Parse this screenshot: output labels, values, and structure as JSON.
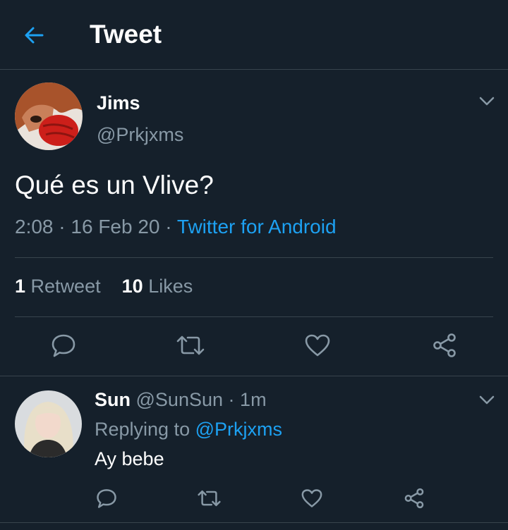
{
  "header": {
    "title": "Tweet",
    "back_icon": "arrow-left-icon"
  },
  "tweet": {
    "author_name": "Jims",
    "author_handle": "@Prkjxms",
    "text": "Qué es un Vlive?",
    "time": "2:08",
    "sep1": "·",
    "date": "16 Feb 20",
    "sep2": "·",
    "source": "Twitter for Android",
    "retweet_count": "1",
    "retweet_label": "Retweet",
    "like_count": "10",
    "like_label": "Likes",
    "actions": [
      "reply-icon",
      "retweet-icon",
      "like-icon",
      "share-icon"
    ]
  },
  "reply": {
    "author_name": "Sun",
    "author_handle": "@SunSun",
    "sep": "·",
    "time": "1m",
    "replying_prefix": "Replying to",
    "replying_to": "@Prkjxms",
    "text": "Ay bebe"
  },
  "colors": {
    "background": "#15202b",
    "accent": "#1da1f2",
    "secondary_text": "#8899a6",
    "divider": "#38444d"
  }
}
